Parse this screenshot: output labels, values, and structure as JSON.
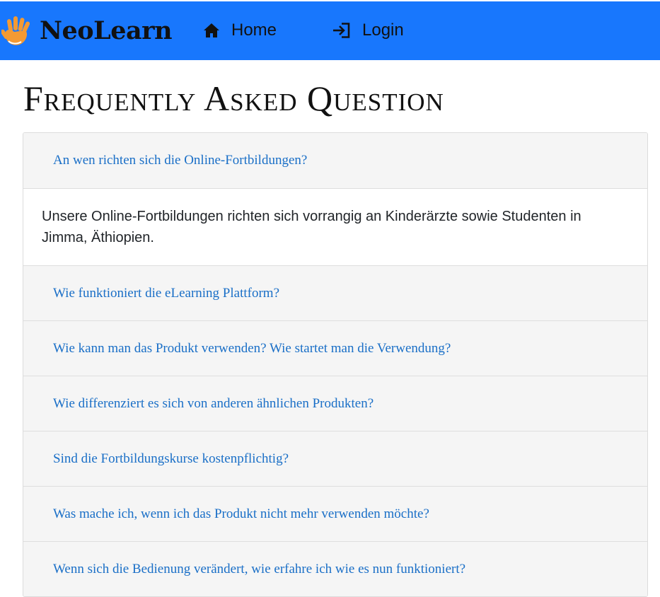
{
  "header": {
    "brand_name": "NeoLearn",
    "brand_icon": "waving-hand-icon",
    "nav": [
      {
        "label": "Home",
        "icon": "home-icon"
      },
      {
        "label": "Login",
        "icon": "login-icon"
      }
    ],
    "colors": {
      "bar": "#1877fd",
      "hand": "#f39a33"
    }
  },
  "page": {
    "title": "Frequently Asked Question"
  },
  "faq": {
    "items": [
      {
        "question": "An wen richten sich die Online-Fortbildungen?",
        "answer": "Unsere Online-Fortbildungen richten sich vorrangig an Kinderärzte sowie Studenten in Jimma, Äthiopien.",
        "expanded": true
      },
      {
        "question": "Wie funktioniert die eLearning Plattform?"
      },
      {
        "question": "Wie kann man das Produkt verwenden? Wie startet man die Verwendung?"
      },
      {
        "question": "Wie differenziert es sich von anderen ähnlichen Produkten?"
      },
      {
        "question": "Sind die Fortbildungskurse kostenpflichtig?"
      },
      {
        "question": "Was mache ich, wenn ich das Produkt nicht mehr verwenden möchte?"
      },
      {
        "question": "Wenn sich die Bedienung verändert, wie erfahre ich wie es nun funktioniert?"
      }
    ],
    "colors": {
      "question_text": "#1a6fc7",
      "question_bg": "#f5f5f5"
    }
  }
}
